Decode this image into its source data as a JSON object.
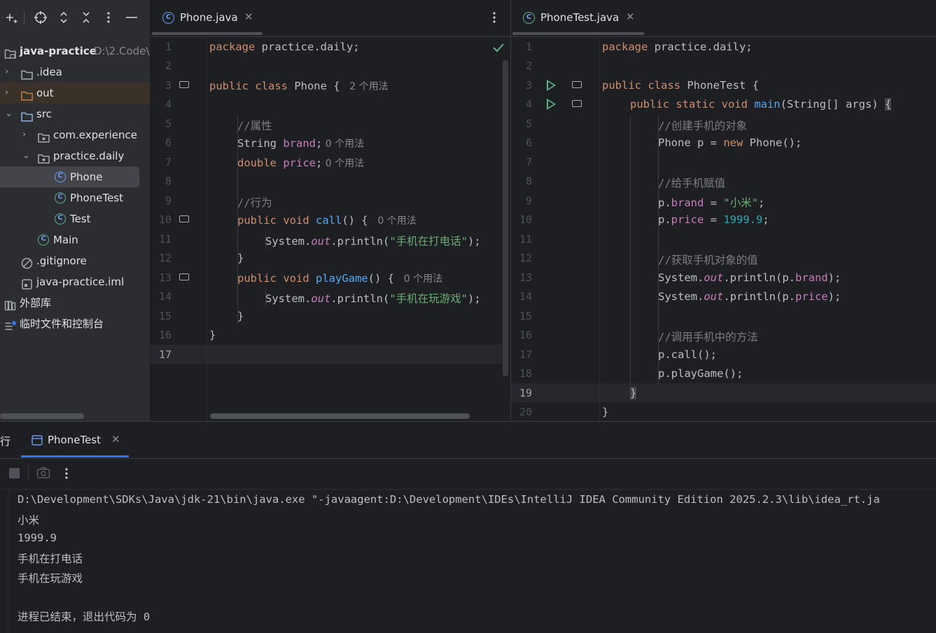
{
  "project_panel": {
    "root_name": "java-practice",
    "root_path": "D:\\2.Code\\",
    "items": [
      {
        "label": ".idea",
        "kind": "folder"
      },
      {
        "label": "out",
        "kind": "folder-excluded"
      },
      {
        "label": "src",
        "kind": "folder"
      },
      {
        "label": "com.experience",
        "kind": "package"
      },
      {
        "label": "practice.daily",
        "kind": "package"
      },
      {
        "label": "Phone",
        "kind": "class"
      },
      {
        "label": "PhoneTest",
        "kind": "class-runnable"
      },
      {
        "label": "Test",
        "kind": "class-runnable"
      },
      {
        "label": "Main",
        "kind": "class-runnable"
      },
      {
        "label": ".gitignore",
        "kind": "ignore-file"
      },
      {
        "label": "java-practice.iml",
        "kind": "module-file"
      },
      {
        "label": "外部库",
        "kind": "libraries"
      },
      {
        "label": "临时文件和控制台",
        "kind": "scratches"
      }
    ],
    "selected": "Phone"
  },
  "left_editor": {
    "tab_label": "Phone.java",
    "inspection_status": "ok-checkmark",
    "current_line": 17,
    "line_numbers": [
      "1",
      "2",
      "3",
      "4",
      "5",
      "6",
      "7",
      "8",
      "9",
      "10",
      "11",
      "12",
      "13",
      "14",
      "15",
      "16",
      "17"
    ],
    "code": {
      "l1_kw": "package",
      "l1_rest": " practice.daily;",
      "l3_kw": "public class",
      "l3_name": " Phone { ",
      "l3_hint": " 2 个用法",
      "l5": "//属性",
      "l6_type": "String ",
      "l6_field": "brand",
      "l6_semi": ";",
      "l6_hint": " 0 个用法",
      "l7_kw": "double ",
      "l7_field": "price",
      "l7_semi": ";",
      "l7_hint": " 0 个用法",
      "l9": "//行为",
      "l10_kw": "public void ",
      "l10_fn": "call",
      "l10_rest": "() { ",
      "l10_hint": " 0 个用法",
      "l11_a": "System.",
      "l11_out": "out",
      "l11_b": ".println(",
      "l11_str": "\"手机在打电话\"",
      "l11_c": ");",
      "l12": "}",
      "l13_kw": "public void ",
      "l13_fn": "playGame",
      "l13_rest": "() { ",
      "l13_hint": " 0 个用法",
      "l14_a": "System.",
      "l14_out": "out",
      "l14_b": ".println(",
      "l14_str": "\"手机在玩游戏\"",
      "l14_c": ");",
      "l15": "}",
      "l16": "}"
    }
  },
  "right_editor": {
    "tab_label": "PhoneTest.java",
    "current_line": 19,
    "line_numbers": [
      "1",
      "2",
      "3",
      "4",
      "5",
      "6",
      "7",
      "8",
      "9",
      "10",
      "11",
      "12",
      "13",
      "14",
      "15",
      "16",
      "17",
      "18",
      "19",
      "20"
    ],
    "code": {
      "l1_kw": "package",
      "l1_rest": " practice.daily;",
      "l3_kw": "public class",
      "l3_name": " PhoneTest {",
      "l4_kw": "public static void ",
      "l4_fn": "main",
      "l4_rest": "(String[] args) ",
      "l4_brace": "{",
      "l5": "//创建手机的对象",
      "l6_a": "Phone p = ",
      "l6_kw": "new",
      "l6_b": " Phone();",
      "l8": "//给手机赋值",
      "l9_a": "p.",
      "l9_f": "brand",
      "l9_b": " = ",
      "l9_str": "\"小米\"",
      "l9_c": ";",
      "l10_a": "p.",
      "l10_f": "price",
      "l10_b": " = ",
      "l10_num": "1999.9",
      "l10_c": ";",
      "l12": "//获取手机对象的值",
      "l13_a": "System.",
      "l13_out": "out",
      "l13_b": ".println(p.",
      "l13_f": "brand",
      "l13_c": ");",
      "l14_a": "System.",
      "l14_out": "out",
      "l14_b": ".println(p.",
      "l14_f": "price",
      "l14_c": ");",
      "l16": "//调用手机中的方法",
      "l17": "p.call();",
      "l18": "p.playGame();",
      "l19": "}",
      "l20": "}"
    }
  },
  "run_panel": {
    "side_label": "行",
    "tab_label": "PhoneTest",
    "output": [
      "D:\\Development\\SDKs\\Java\\jdk-21\\bin\\java.exe \"-javaagent:D:\\Development\\IDEs\\IntelliJ IDEA Community Edition 2025.2.3\\lib\\idea_rt.ja",
      "小米",
      "1999.9",
      "手机在打电话",
      "手机在玩游戏",
      "",
      "进程已结束，退出代码为 0"
    ]
  },
  "colors": {
    "background": "#1e1f22",
    "panel": "#2b2d30",
    "keyword": "#cf8e6d",
    "field": "#c77dbb",
    "function": "#56a8f5",
    "string": "#6aab73",
    "number": "#2aacb8",
    "comment": "#7a7e85",
    "run_green": "#5fb38b",
    "accent_blue": "#3574f0"
  }
}
